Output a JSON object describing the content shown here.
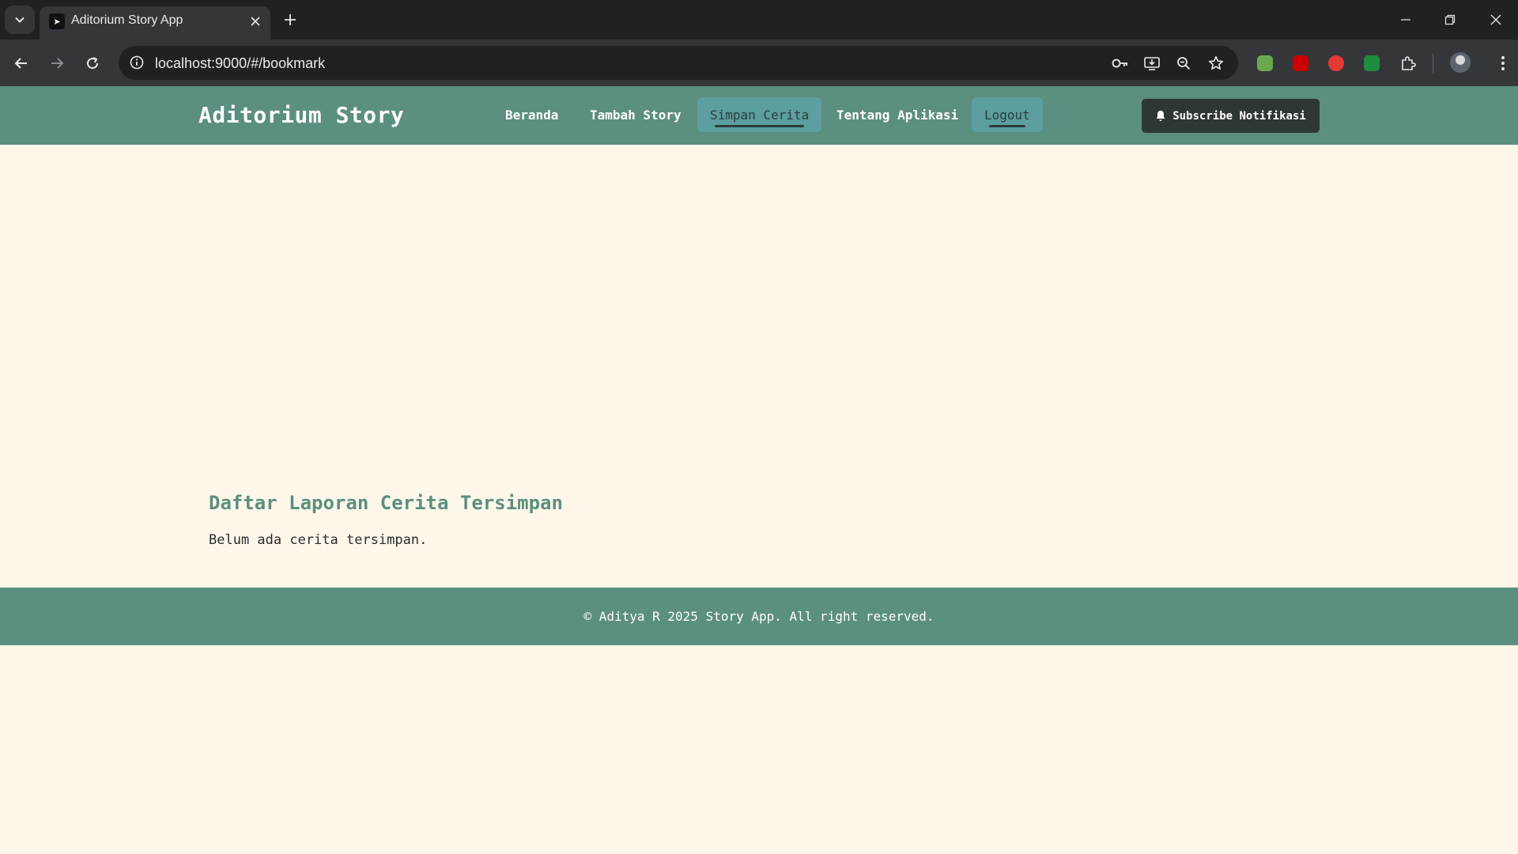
{
  "browser": {
    "tab_title": "Aditorium Story App",
    "url": "localhost:9000/#/bookmark",
    "extension_colors": [
      "#6aa84f",
      "#cc0000",
      "#e53935",
      "#1e8e3e"
    ]
  },
  "header": {
    "brand": "Aditorium Story",
    "nav": [
      {
        "label": "Beranda",
        "active": false
      },
      {
        "label": "Tambah Story",
        "active": false
      },
      {
        "label": "Simpan Cerita",
        "active": true
      },
      {
        "label": "Tentang Aplikasi",
        "active": false
      },
      {
        "label": "Logout",
        "active": true
      }
    ],
    "subscribe_label": "Subscribe Notifikasi",
    "subscribe_icon": "bell-icon"
  },
  "main": {
    "title": "Daftar Laporan Cerita Tersimpan",
    "empty_text": "Belum ada cerita tersimpan."
  },
  "footer": {
    "text": "© Aditya R 2025 Story App. All right reserved."
  },
  "colors": {
    "primary": "#5b8f7f",
    "active_nav": "#5d9ea0",
    "background": "#fff8ea",
    "button_dark": "#2f3638"
  }
}
